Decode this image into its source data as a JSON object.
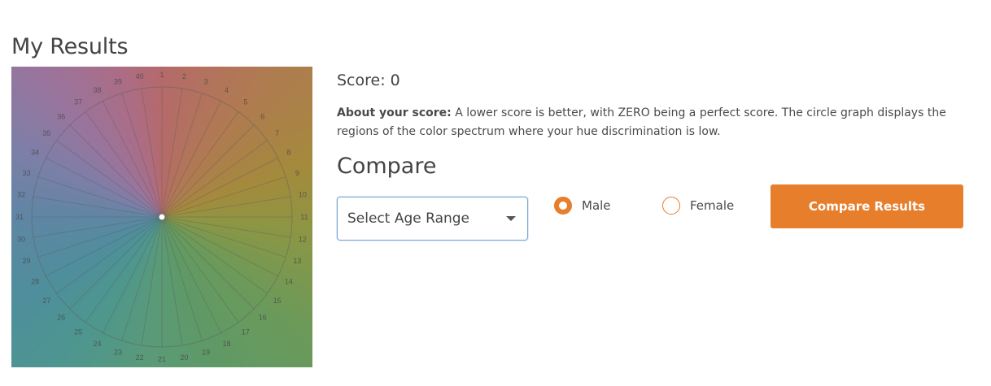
{
  "page": {
    "title": "My Results"
  },
  "wheel": {
    "labels": [
      "1",
      "2",
      "3",
      "4",
      "5",
      "6",
      "7",
      "8",
      "9",
      "10",
      "11",
      "12",
      "13",
      "14",
      "15",
      "16",
      "17",
      "18",
      "19",
      "20",
      "21",
      "22",
      "23",
      "24",
      "25",
      "26",
      "27",
      "28",
      "29",
      "30",
      "31",
      "32",
      "33",
      "34",
      "35",
      "36",
      "37",
      "38",
      "39",
      "40"
    ]
  },
  "results": {
    "score": "Score: 0",
    "about_label": "About your score:",
    "about_text": " A lower score is better, with ZERO being a perfect score. The circle graph displays the regions of the color spectrum where your hue discrimination is low."
  },
  "compare": {
    "heading": "Compare",
    "age_select": {
      "selected": "Select Age Range"
    },
    "gender_options": [
      {
        "label": "Male",
        "checked": true
      },
      {
        "label": "Female",
        "checked": false
      }
    ],
    "button_label": "Compare Results"
  },
  "colors": {
    "accent": "#e67e2c",
    "select_border": "#7aa7d6"
  }
}
